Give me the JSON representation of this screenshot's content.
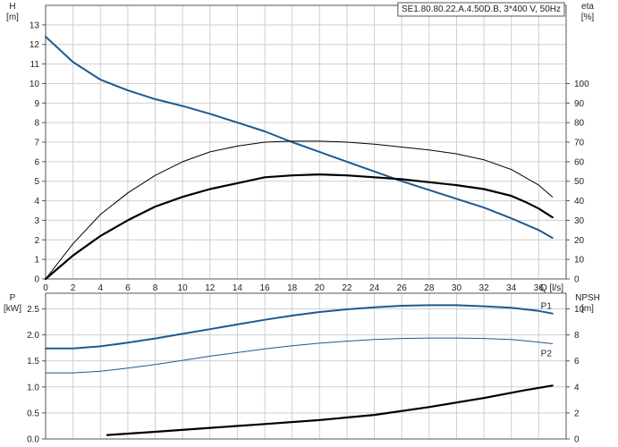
{
  "chart_data": [
    {
      "type": "line",
      "title": "SE1.80.80.22.A.4.50D.B, 3*400 V, 50Hz",
      "xlabel": "Q [l/s]",
      "ylabel": "H\n[m]",
      "y2label": "eta\n[%]",
      "xlim": [
        0,
        38
      ],
      "ylim": [
        0,
        14
      ],
      "y2lim": [
        0,
        140
      ],
      "x_ticks": [
        "0",
        "2",
        "4",
        "6",
        "8",
        "10",
        "12",
        "14",
        "16",
        "18",
        "20",
        "22",
        "24",
        "26",
        "28",
        "30",
        "32",
        "34",
        "36"
      ],
      "y_ticks": [
        "0",
        "1",
        "2",
        "3",
        "4",
        "5",
        "6",
        "7",
        "8",
        "9",
        "10",
        "11",
        "12",
        "13"
      ],
      "y2_ticks": [
        "0",
        "10",
        "20",
        "30",
        "40",
        "50",
        "60",
        "70",
        "80",
        "90",
        "100"
      ],
      "grid": true,
      "series": [
        {
          "axis": "left",
          "color": "#1f5a8f",
          "stroke": 2,
          "x": [
            0,
            2,
            4,
            6,
            8,
            10,
            12,
            14,
            16,
            18,
            20,
            22,
            24,
            26,
            28,
            30,
            32,
            34,
            35,
            36,
            37
          ],
          "values": [
            12.4,
            11.1,
            10.2,
            9.65,
            9.2,
            8.85,
            8.45,
            8.0,
            7.55,
            7.0,
            6.5,
            6.0,
            5.5,
            5.0,
            4.55,
            4.1,
            3.65,
            3.1,
            2.8,
            2.5,
            2.1
          ]
        },
        {
          "axis": "right",
          "color": "#000000",
          "stroke": 1,
          "x": [
            0,
            2,
            4,
            6,
            8,
            10,
            12,
            14,
            16,
            18,
            20,
            22,
            24,
            26,
            28,
            30,
            32,
            34,
            35,
            36,
            37
          ],
          "values": [
            0,
            18,
            33,
            44,
            53,
            60,
            65,
            68,
            70,
            70.5,
            70.5,
            70,
            69,
            67.5,
            66,
            64,
            61,
            56,
            52,
            48,
            42
          ]
        },
        {
          "axis": "right",
          "color": "#000000",
          "stroke": 2.2,
          "x": [
            0,
            2,
            4,
            6,
            8,
            10,
            12,
            14,
            16,
            18,
            20,
            22,
            24,
            26,
            28,
            30,
            32,
            34,
            35,
            36,
            37
          ],
          "values": [
            0,
            12,
            22,
            30,
            37,
            42,
            46,
            49,
            52,
            53,
            53.5,
            53,
            52,
            51,
            49.5,
            48,
            46,
            42.5,
            39.5,
            36,
            31.5
          ]
        }
      ]
    },
    {
      "type": "line",
      "xlabel": "",
      "ylabel": "P\n[kW]",
      "y2label": "NPSH\n[m]",
      "xlim": [
        0,
        38
      ],
      "ylim": [
        0,
        2.8
      ],
      "y2lim": [
        0,
        11.2
      ],
      "y_ticks": [
        "0.0",
        "0.5",
        "1.0",
        "1.5",
        "2.0",
        "2.5"
      ],
      "y2_ticks": [
        "0",
        "2",
        "4",
        "6",
        "8",
        "10"
      ],
      "grid": true,
      "series": [
        {
          "name": "P1",
          "axis": "left",
          "color": "#1f5a8f",
          "stroke": 2,
          "x": [
            0,
            2,
            4,
            6,
            8,
            10,
            12,
            14,
            16,
            18,
            20,
            22,
            24,
            26,
            28,
            30,
            32,
            34,
            36,
            37
          ],
          "values": [
            1.74,
            1.74,
            1.78,
            1.85,
            1.93,
            2.02,
            2.11,
            2.2,
            2.29,
            2.37,
            2.44,
            2.49,
            2.53,
            2.56,
            2.57,
            2.57,
            2.55,
            2.52,
            2.46,
            2.41
          ]
        },
        {
          "name": "P2",
          "axis": "left",
          "color": "#1f5a8f",
          "stroke": 1,
          "x": [
            0,
            2,
            4,
            6,
            8,
            10,
            12,
            14,
            16,
            18,
            20,
            22,
            24,
            26,
            28,
            30,
            32,
            34,
            36,
            37
          ],
          "values": [
            1.27,
            1.27,
            1.3,
            1.36,
            1.43,
            1.51,
            1.59,
            1.66,
            1.73,
            1.79,
            1.84,
            1.88,
            1.91,
            1.93,
            1.94,
            1.94,
            1.93,
            1.91,
            1.86,
            1.83
          ]
        },
        {
          "axis": "right",
          "color": "#000000",
          "stroke": 2.2,
          "x": [
            4.5,
            8,
            12,
            16,
            20,
            24,
            28,
            32,
            35,
            37
          ],
          "values": [
            0.3,
            0.55,
            0.85,
            1.15,
            1.45,
            1.85,
            2.45,
            3.15,
            3.75,
            4.1
          ]
        }
      ]
    }
  ]
}
